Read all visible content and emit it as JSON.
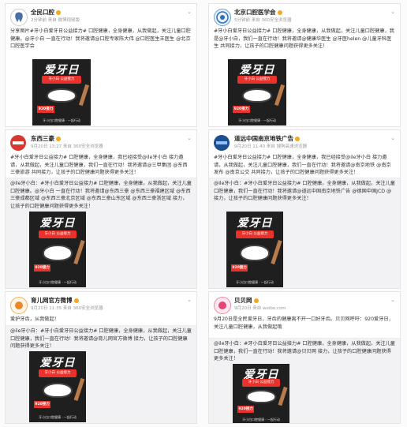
{
  "colors": {
    "link": "#1e7dd6",
    "poster_bg": "#1f1f1f",
    "accent": "#e8322b",
    "verified": "#f5a623"
  },
  "poster": {
    "title": "爱牙日",
    "ribbon": "牙小白 公益接力",
    "badge": "920接力",
    "footer": "牙小白口腔健康 · 一起行动"
  },
  "cards": [
    {
      "name": "全民口腔",
      "meta": "2分钟前 来自 微博视频版",
      "text": "分享图片#牙小白爱牙日公益接力# 口腔健康，全身健康，从我做起，关注儿童口腔健康。@牙小白 一直在行动！我将邀请@口腔专家陈大伟 @口腔医生王医生 @北京口腔医学会",
      "repost": ""
    },
    {
      "name": "北京口腔医学会",
      "meta": "5分钟前 来自 360安全浏览器",
      "text": "#牙小白爱牙日公益接力# 口腔健康，全身健康，从我做起，关注儿童口腔健康，我是@牙小白，我们一直在行动！我将邀请@健康华医生 @牙医helen @儿童牙科医生 共同接力，让孩子的口腔健康问题获得更多关注！",
      "repost": ""
    },
    {
      "name": "东西三豪",
      "meta": "9月20日 13:27 来自 360安全浏览器",
      "text": "#牙小白爱牙日公益接力# 口腔健康，全身健康，我已经接受@ile牙小白 接力邀请，从我做起，关注儿童口腔健康，我们一直在行动！我将邀请@三甲集团 @东西三豪旅游 共同接力，让孩子的口腔健康问题获得更多关注！",
      "repost": "@ile牙小白：#牙小白爱牙日公益接力# 口腔健康，全身健康，从我做起，关注儿童口腔健康。@牙小白 一直在行动！我将邀请@东西三豪 @东西三豪福建区域 @东西三豪成都区域 @东西三豪北京区域 @东西三豪山东区域 @东西三豪浙区域 接力，让孩子的口腔健康问题获得更多关注！"
    },
    {
      "name": "道远中国南京地铁广告",
      "meta": "9月20日 11:40 来自 搜狗高速浏览器",
      "text": "#牙小白爱牙日公益接力# 口腔健康，全身健康，我已经接受@ile牙小白 接力邀请，从我做起，关注儿童口腔健康，我们一直在行动！我将邀请@南京地铁 @南京发布 @南京公交 共同接力，让孩子的口腔健康问题获得更多关注！",
      "repost": "@ile牙小白：#牙小白爱牙日公益接力# 口腔健康，全身健康，从我做起，关注儿童口腔健康，我们一直在行动！我将邀请@道远中国南京地铁广告 @德国中国JCD @ 接力，让孩子的口腔健康问题获得更多关注！"
    },
    {
      "name": "育儿网官方微博",
      "meta": "9月20日 11:35 来自 360安全浏览器",
      "text": "爱护牙齿，从我做起！",
      "repost": "@ile牙小白：#牙小白爱牙日公益接力# 口腔健康，全身健康，从我做起，关注儿童口腔健康，我们一直在行动！我将邀请@育儿网官方微博 接力，让孩子的口腔健康问题获得更多关注！"
    },
    {
      "name": "贝贝网",
      "meta": "9月20日 来自 weibo.com",
      "text": "9月20日是全民爱牙日，牙齿的健康离不开一口好牙齿。贝贝网呼吁：920爱牙日，关注儿童口腔健康，从我做起哦",
      "repost": "@ile牙小白：#牙小白爱牙日公益接力# 口腔健康，全身健康，从我做起，关注儿童口腔健康，我们一直在行动！我将邀请@贝贝网 接力，让孩子的口腔健康问题获得更多关注！"
    }
  ]
}
